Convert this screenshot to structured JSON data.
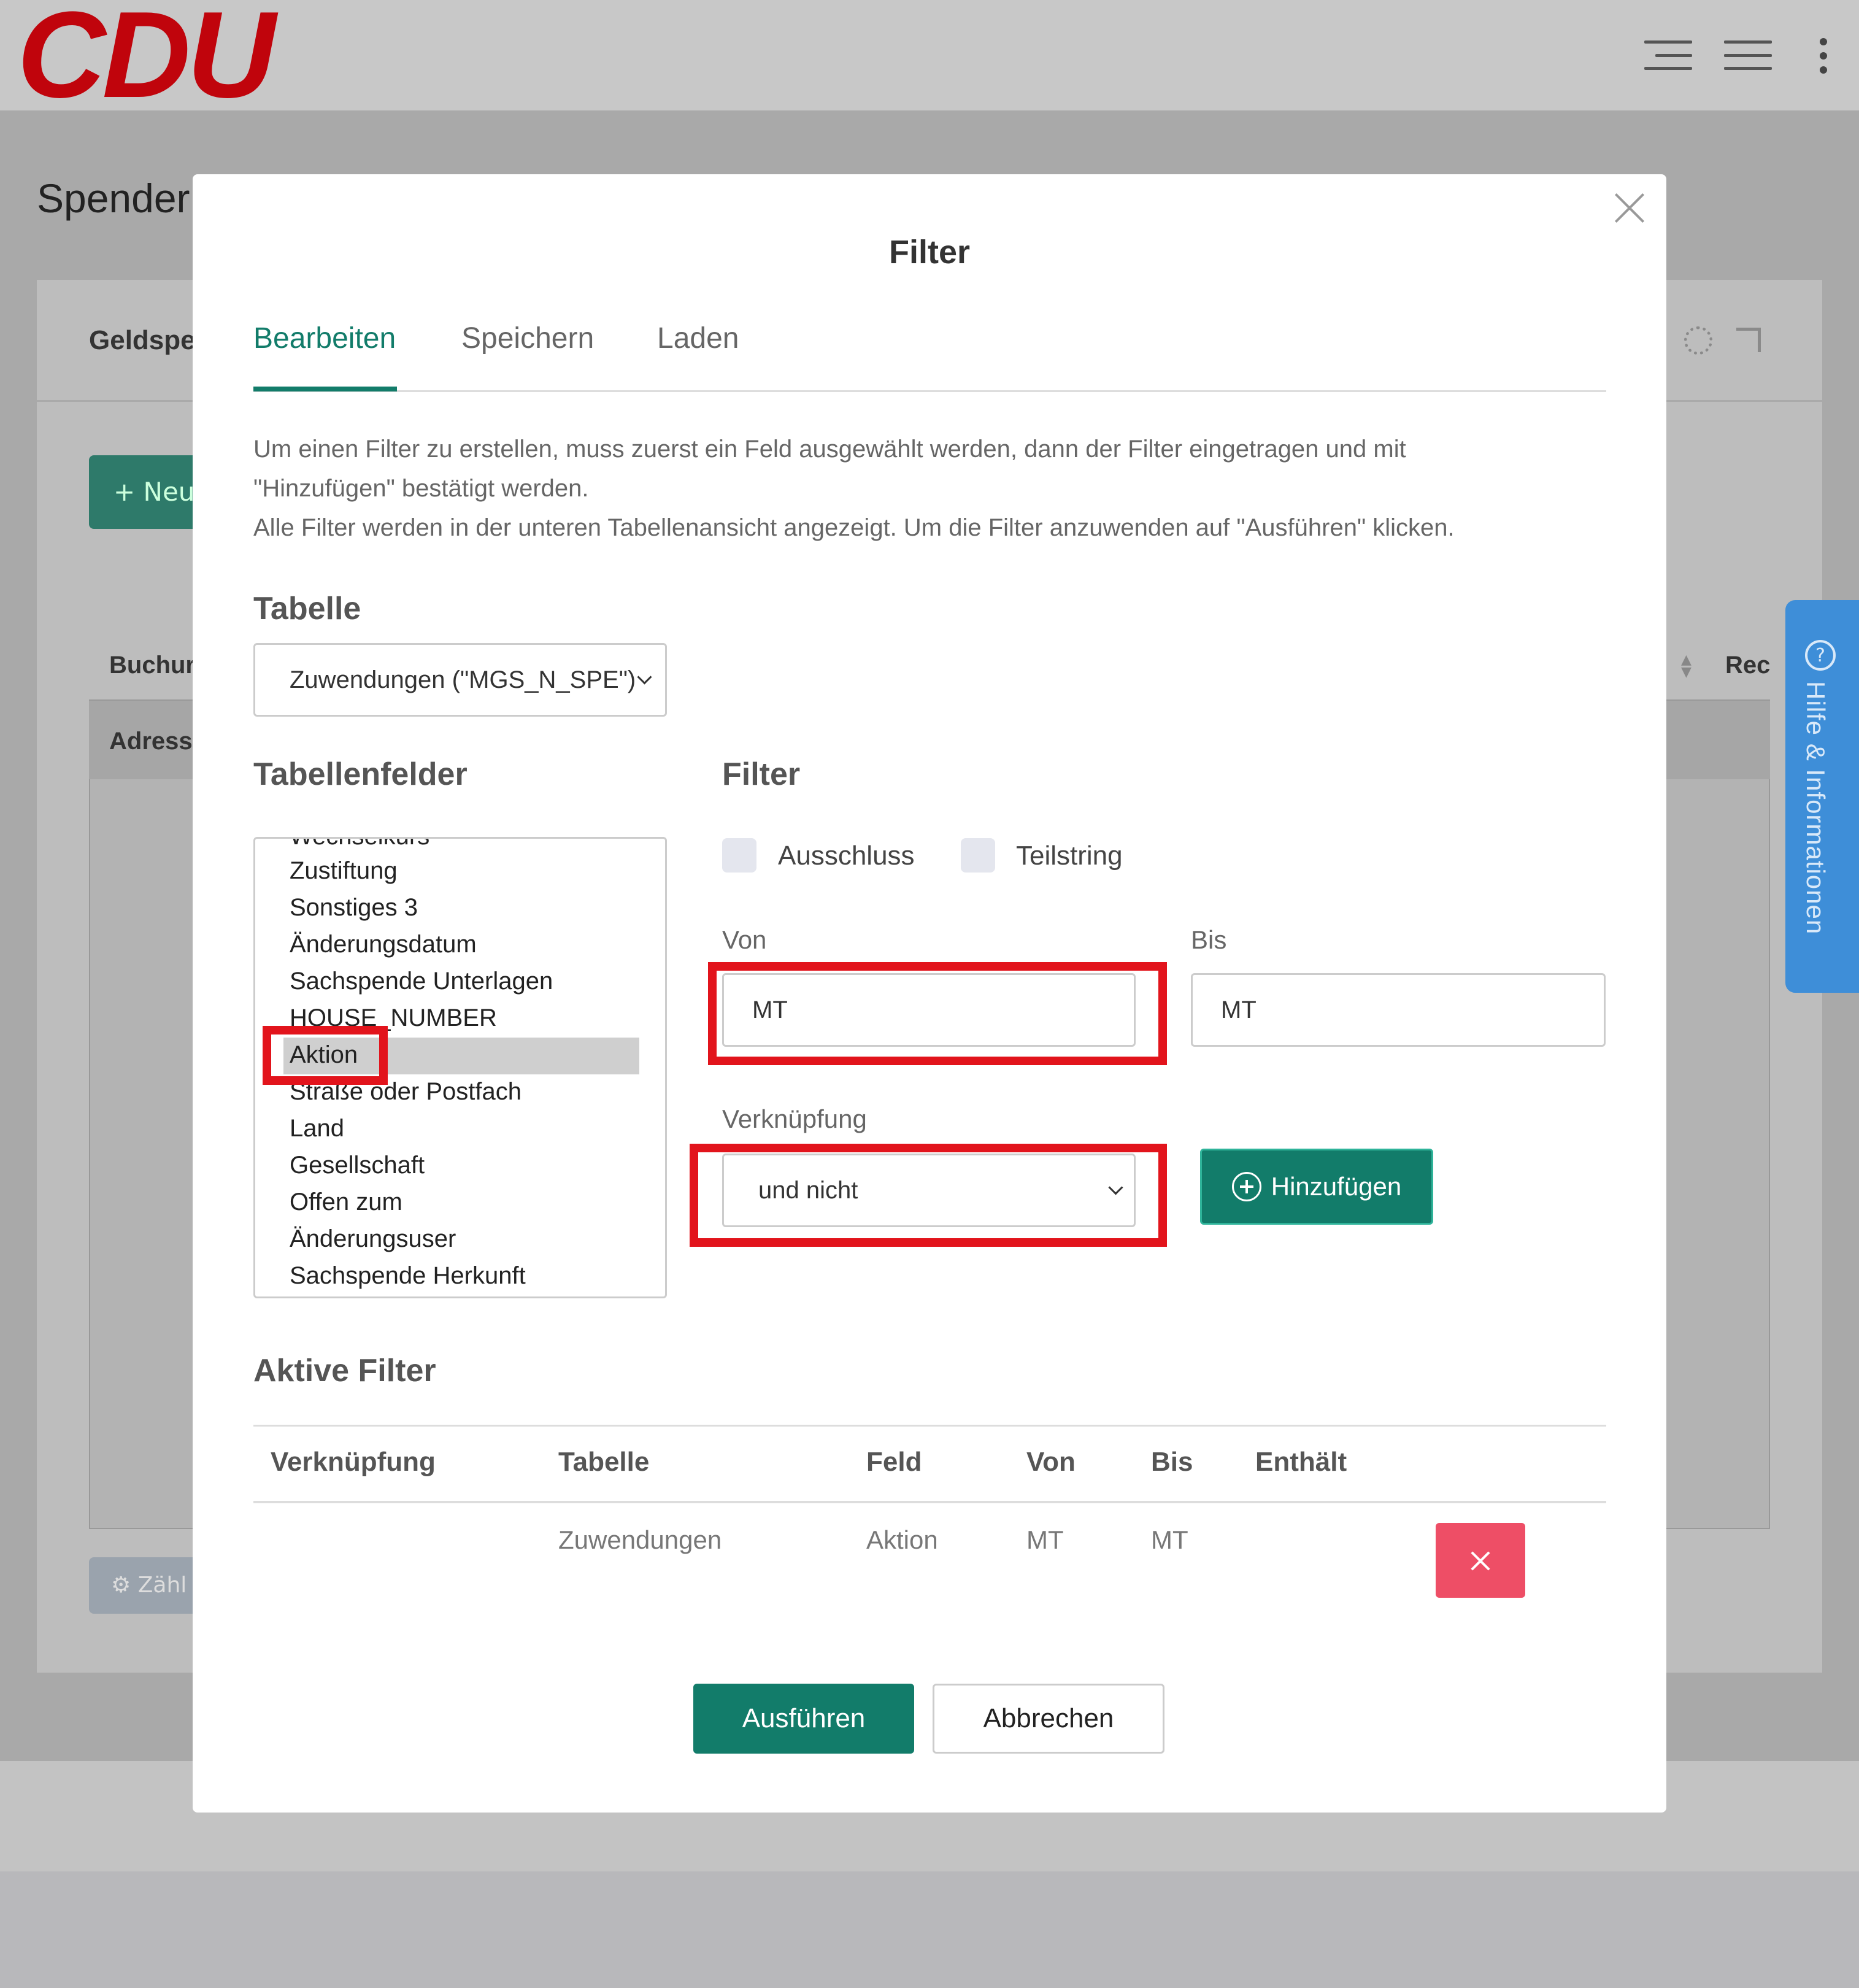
{
  "app": {
    "logo_text": "CDU",
    "brand_color": "#c0040c",
    "accent_color": "#127c6a"
  },
  "header": {
    "icons": [
      "list-indent-icon",
      "hamburger-menu-icon",
      "kebab-menu-icon"
    ]
  },
  "background_page": {
    "title": "Spender",
    "card_title": "Geldspe",
    "new_button_label": "Neu",
    "table_col1": "Buchur",
    "table_col_last": "Rec",
    "table_subrow": "Adress",
    "count_button_label": "Zähl"
  },
  "help_tab": {
    "label": "Hilfe & Informationen",
    "icon": "question-circle-icon"
  },
  "modal": {
    "title": "Filter",
    "tabs": [
      {
        "label": "Bearbeiten",
        "active": true
      },
      {
        "label": "Speichern",
        "active": false
      },
      {
        "label": "Laden",
        "active": false
      }
    ],
    "description": [
      "Um einen Filter zu erstellen, muss zuerst ein Feld ausgewählt werden, dann der Filter eingetragen und mit",
      "\"Hinzufügen\" bestätigt werden.",
      "Alle Filter werden in der unteren Tabellenansicht angezeigt. Um die Filter anzuwenden auf \"Ausführen\" klicken."
    ],
    "table_section": {
      "heading": "Tabelle",
      "selected": "Zuwendungen (\"MGS_N_SPE\")"
    },
    "fields_section": {
      "heading": "Tabellenfelder",
      "items": [
        "Wechselkurs",
        "Zustiftung",
        "Sonstiges 3",
        "Änderungsdatum",
        "Sachspende Unterlagen",
        "HOUSE_NUMBER",
        "Aktion",
        "Straße oder Postfach",
        "Land",
        "Gesellschaft",
        "Offen zum",
        "Änderungsuser",
        "Sachspende Herkunft"
      ],
      "selected_item": "Aktion"
    },
    "filter_section": {
      "heading": "Filter",
      "checkbox_exclude": "Ausschluss",
      "checkbox_substring": "Teilstring",
      "from_label": "Von",
      "from_value": "MT",
      "to_label": "Bis",
      "to_value": "MT",
      "link_label": "Verknüpfung",
      "link_value": "und nicht",
      "add_button": "Hinzufügen"
    },
    "active_filters": {
      "heading": "Aktive Filter",
      "columns": [
        "Verknüpfung",
        "Tabelle",
        "Feld",
        "Von",
        "Bis",
        "Enthält"
      ],
      "rows": [
        {
          "link": "",
          "table": "Zuwendungen",
          "field": "Aktion",
          "from": "MT",
          "to": "MT",
          "contains": ""
        }
      ]
    },
    "run_button": "Ausführen",
    "cancel_button": "Abbrechen"
  },
  "highlight_color": "#e2141c"
}
